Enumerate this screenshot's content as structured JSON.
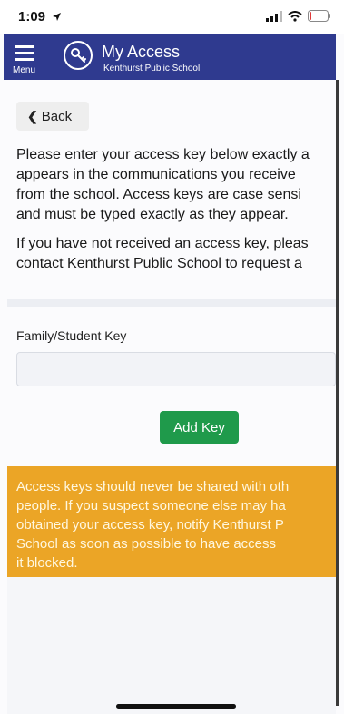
{
  "status_bar": {
    "time": "1:09"
  },
  "header": {
    "menu_label": "Menu",
    "title": "My Access",
    "subtitle": "Kenthurst Public School"
  },
  "back_button": {
    "label": "Back"
  },
  "intro": {
    "lines_p1": [
      "Please enter your access key below exactly a",
      "appears in the communications you receive",
      "from the school. Access keys are case sensi",
      "and must be typed exactly as they appear."
    ],
    "lines_p2": [
      "If you have not received an access key, pleas",
      "contact Kenthurst Public School to request a"
    ]
  },
  "form": {
    "field_label": "Family/Student Key",
    "field_value": "",
    "add_button": "Add Key"
  },
  "warning": {
    "lines": [
      "Access keys should never be shared with oth",
      "people. If you suspect someone else may ha",
      "obtained your access key, notify Kenthurst P",
      "School as soon as possible to have access",
      "it blocked."
    ]
  },
  "colors": {
    "nav_bg": "#2f3a8f",
    "add_button_bg": "#1f9a4b",
    "warning_bg": "#eba526"
  },
  "icons": [
    "location-arrow-icon",
    "signal-icon",
    "wifi-icon",
    "battery-icon",
    "menu-icon",
    "key-icon",
    "chevron-left-icon"
  ]
}
